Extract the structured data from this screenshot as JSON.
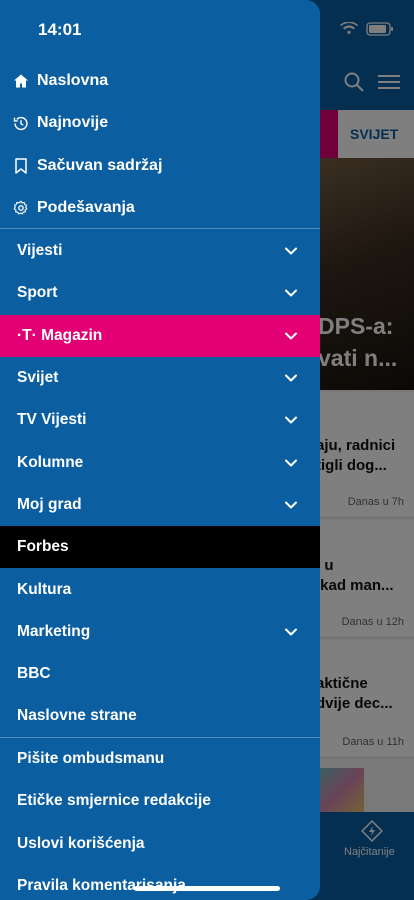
{
  "status_bar": {
    "time": "14:01"
  },
  "background": {
    "tab_label": "SVIJET",
    "hero_title_line1": "DPS-a:",
    "hero_title_line2": "vati n...",
    "articles": [
      {
        "line1": "aju, radnici",
        "line2": "tigli dog...",
        "time": "Danas u 7h"
      },
      {
        "line1": "i u",
        "line2": "ikad man...",
        "time": "Danas u 12h"
      },
      {
        "line1": "aktične",
        "line2": "dvije dec...",
        "time": "Danas u 11h"
      }
    ],
    "bottom_tab_label": "Najčitanije",
    "accent": "#0b5ea0"
  },
  "drawer": {
    "background_color": "#0b5ea0",
    "primary": [
      {
        "label": "Naslovna",
        "icon": "home-icon"
      },
      {
        "label": "Najnovije",
        "icon": "clock-icon"
      },
      {
        "label": "Sačuvan sadržaj",
        "icon": "bookmark-icon"
      },
      {
        "label": "Podešavanja",
        "icon": "gear-icon"
      }
    ],
    "sections": [
      {
        "label": "Vijesti",
        "expandable": true
      },
      {
        "label": "Sport",
        "expandable": true
      },
      {
        "label": "Magazin",
        "prefix": "·T·",
        "expandable": true,
        "highlight_color": "#e20074"
      },
      {
        "label": "Svijet",
        "expandable": true
      },
      {
        "label": "TV Vijesti",
        "expandable": true
      },
      {
        "label": "Kolumne",
        "expandable": true
      },
      {
        "label": "Moj grad",
        "expandable": true
      },
      {
        "label": "Forbes",
        "expandable": false,
        "highlight_color": "#000000"
      },
      {
        "label": "Kultura",
        "expandable": false
      },
      {
        "label": "Marketing",
        "expandable": true
      },
      {
        "label": "BBC",
        "expandable": false
      },
      {
        "label": "Naslovne strane",
        "expandable": false
      }
    ],
    "footer": [
      {
        "label": "Pišite ombudsmanu"
      },
      {
        "label": "Etičke smjernice redakcije"
      },
      {
        "label": "Uslovi korišćenja"
      },
      {
        "label": "Pravila komentarisanja"
      }
    ]
  }
}
